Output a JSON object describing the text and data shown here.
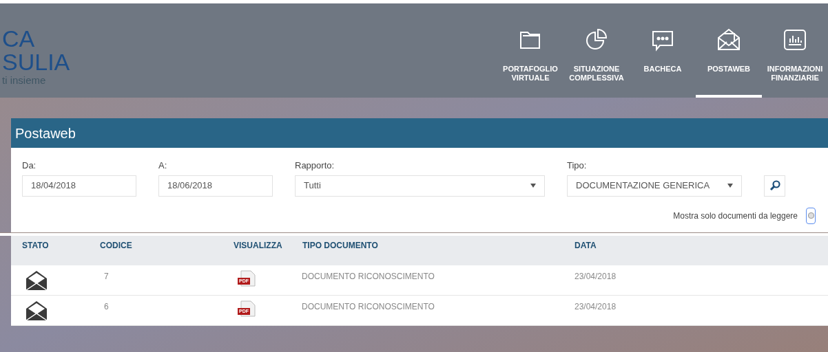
{
  "logo": {
    "lines": [
      "CA",
      "SULIA"
    ],
    "tagline": "ti insieme"
  },
  "nav": [
    {
      "kind": "folder",
      "label": [
        "PORTAFOGLIO",
        "VIRTUALE"
      ],
      "selected": false
    },
    {
      "kind": "pie",
      "label": [
        "SITUAZIONE",
        "COMPLESSIVA"
      ],
      "selected": false
    },
    {
      "kind": "chat",
      "label": [
        "BACHECA"
      ],
      "selected": false
    },
    {
      "kind": "mail",
      "label": [
        "POSTAWEB"
      ],
      "selected": true
    },
    {
      "kind": "chart",
      "label": [
        "INFORMAZIONI",
        "FINANZIARIE"
      ],
      "selected": false
    }
  ],
  "panel": {
    "title": "Postaweb",
    "filters": [
      {
        "kind": "date",
        "label": "Da:",
        "value": "18/04/2018"
      },
      {
        "kind": "date",
        "label": "A:",
        "value": "18/06/2018"
      },
      {
        "kind": "select",
        "label": "Rapporto:",
        "value": "Tutti"
      },
      {
        "kind": "select",
        "label": "Tipo:",
        "value": "DOCUMENTAZIONE GENERICA"
      }
    ],
    "unread_only": {
      "label": "Mostra solo documenti da leggere",
      "checked": false
    }
  },
  "table": {
    "columns": [
      "STATO",
      "CODICE",
      "VISUALIZZA",
      "TIPO DOCUMENTO",
      "DATA"
    ],
    "rows": [
      {
        "codice": "7",
        "file": "PDF",
        "tipo": "DOCUMENTO RICONOSCIMENTO",
        "data": "23/04/2018"
      },
      {
        "codice": "6",
        "file": "PDF",
        "tipo": "DOCUMENTO RICONOSCIMENTO",
        "data": "23/04/2018"
      }
    ]
  }
}
